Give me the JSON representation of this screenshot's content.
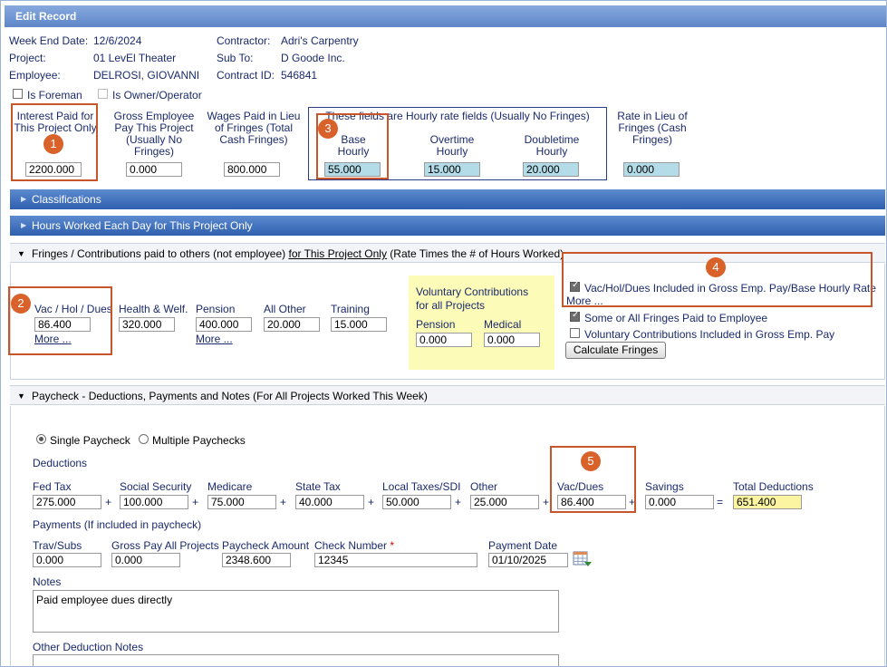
{
  "title": "Edit Record",
  "info": {
    "week_end_label": "Week End Date:",
    "week_end": "12/6/2024",
    "project_label": "Project:",
    "project": "01 LevEl Theater",
    "employee_label": "Employee:",
    "employee": "DELROSI, GIOVANNI",
    "contractor_label": "Contractor:",
    "contractor": "Adri's Carpentry",
    "subto_label": "Sub To:",
    "subto": "D Goode Inc.",
    "contract_label": "Contract ID:",
    "contract": "546841"
  },
  "checks": {
    "foreman": "Is Foreman",
    "owner": "Is Owner/Operator"
  },
  "rates": {
    "interest_l1": "Interest Paid for",
    "interest_l2": "This Project Only",
    "interest": "2200.000",
    "gross_l1": "Gross Employee",
    "gross_l2": "Pay This Project",
    "gross_l3": "(Usually No",
    "gross_l4": "Fringes)",
    "gross": "0.000",
    "wages_l1": "Wages Paid in Lieu",
    "wages_l2": "of Fringes (Total",
    "wages_l3": "Cash Fringes)",
    "wages": "800.000",
    "hourly_note": "These fields are Hourly rate fields (Usually No Fringes)",
    "base_l1": "Base",
    "base_l2": "Hourly",
    "base": "55.000",
    "ot_l1": "Overtime",
    "ot_l2": "Hourly",
    "ot": "15.000",
    "dt_l1": "Doubletime",
    "dt_l2": "Hourly",
    "dt": "20.000",
    "lieu_l1": "Rate in Lieu of",
    "lieu_l2": "Fringes (Cash",
    "lieu_l3": "Fringes)",
    "lieu": "0.000"
  },
  "sections": {
    "classifications": "Classifications",
    "hours": "Hours Worked Each Day for This Project Only",
    "fringes_a": "Fringes / Contributions paid to others (not employee) ",
    "fringes_b": "for This Project Only",
    "fringes_c": " (Rate Times the # of Hours Worked)",
    "paycheck": "Paycheck - Deductions, Payments and Notes (For All Projects Worked This Week)"
  },
  "fringes": {
    "vac_label": "Vac / Hol / Dues",
    "vac": "86.400",
    "health_label": "Health & Welf.",
    "health": "320.000",
    "pension_label": "Pension",
    "pension": "400.000",
    "other_label": "All Other",
    "other": "20.000",
    "training_label": "Training",
    "training": "15.000",
    "more": "More ...",
    "vol_l1": "Voluntary Contributions",
    "vol_l2": "for all Projects",
    "vol_pension_label": "Pension",
    "vol_pension": "0.000",
    "vol_medical_label": "Medical",
    "vol_medical": "0.000",
    "cb_vac_included": "Vac/Hol/Dues Included in Gross Emp. Pay/Base Hourly Rate",
    "cb_some": "Some or All Fringes Paid to Employee",
    "cb_vol": "Voluntary Contributions Included in Gross Emp. Pay",
    "calc_button": "Calculate Fringes"
  },
  "paycheck": {
    "single": "Single Paycheck",
    "multiple": "Multiple Paychecks",
    "deductions": "Deductions",
    "fed_label": "Fed Tax",
    "fed": "275.000",
    "ss_label": "Social Security",
    "ss": "100.000",
    "medicare_label": "Medicare",
    "medicare": "75.000",
    "state_label": "State Tax",
    "state": "40.000",
    "local_label": "Local Taxes/SDI",
    "local": "50.000",
    "other_label": "Other",
    "other": "25.000",
    "vacdues_label": "Vac/Dues",
    "vacdues": "86.400",
    "savings_label": "Savings",
    "savings": "0.000",
    "total_label": "Total Deductions",
    "total": "651.400",
    "plus": "+",
    "equals": "=",
    "payments": "Payments (If included in paycheck)",
    "trav_label": "Trav/Subs",
    "trav": "0.000",
    "grossall_label": "Gross Pay All Projects",
    "grossall": "0.000",
    "amount_label": "Paycheck Amount",
    "amount": "2348.600",
    "check_label": "Check Number",
    "check_req": "*",
    "check": "12345",
    "date_label": "Payment Date",
    "date": "01/10/2025",
    "notes_label": "Notes",
    "notes": "Paid employee dues directly",
    "other_notes_label": "Other Deduction Notes"
  },
  "badges": [
    "1",
    "2",
    "3",
    "4",
    "5"
  ],
  "colors": {
    "accent": "#5d86c9",
    "highlight": "#c8562b",
    "rate_field": "#b4dce8",
    "voluntary_bg": "#fdfbb8",
    "total_field": "#fbf4a0"
  }
}
